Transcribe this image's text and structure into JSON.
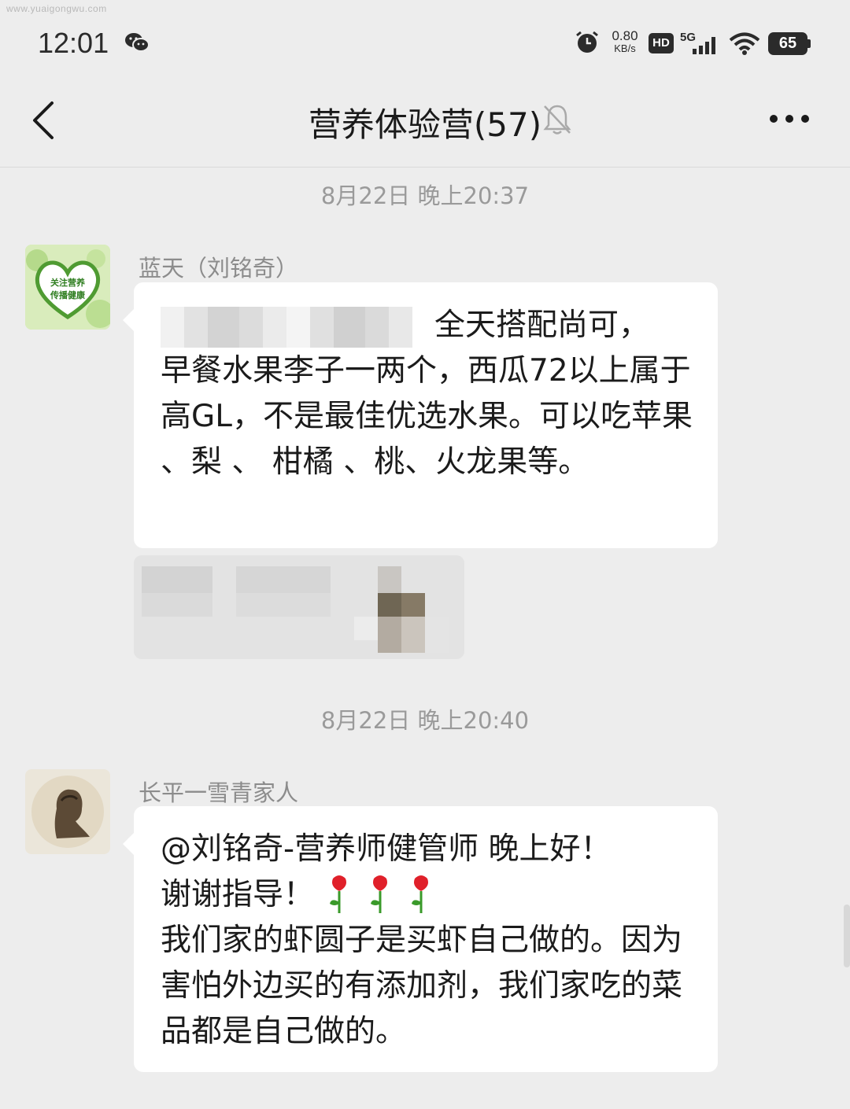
{
  "watermark": "www.yuaigongwu.com",
  "status_bar": {
    "time": "12:01",
    "net_speed_value": "0.80",
    "net_speed_unit": "KB/s",
    "hd_label": "HD",
    "network_type": "5G",
    "battery_level": "65",
    "icons": [
      "wechat-icon",
      "alarm-icon",
      "hd-icon",
      "signal-icon",
      "wifi-icon",
      "battery-icon"
    ]
  },
  "nav": {
    "title": "营养体验营(57)",
    "icons": [
      "back-icon",
      "mute-bell-icon",
      "more-icon"
    ]
  },
  "messages": [
    {
      "timestamp": "8月22日 晚上20:37",
      "sender": "蓝天（刘铭奇）",
      "avatar_icon": "heart-wreath-avatar",
      "avatar_text_line1": "关注营养",
      "avatar_text_line2": "传播健康",
      "text_first_line": "全天搭配尚可，",
      "text_rest": "早餐水果李子一两个，西瓜72以上属于高GL，不是最佳优选水果。可以吃苹果 、梨 、 柑橘 、桃、火龙果等。",
      "quoted_reply": "blurred-quote-card"
    },
    {
      "timestamp": "8月22日 晚上20:40",
      "sender": "长平一雪青家人",
      "avatar_icon": "portrait-avatar",
      "text_line1": "@刘铭奇-营养师健管师  晚上好！",
      "text_line2": "谢谢指导！",
      "emoji": [
        "rose-icon",
        "rose-icon",
        "rose-icon"
      ],
      "text_rest": "我们家的虾圆子是买虾自己做的。因为害怕外边买的有添加剂，我们家吃的菜品都是自己做的。"
    }
  ],
  "colors": {
    "background": "#ededed",
    "bubble": "#ffffff",
    "timestamp": "#9a9a9a",
    "sender": "#8c8c8c"
  }
}
